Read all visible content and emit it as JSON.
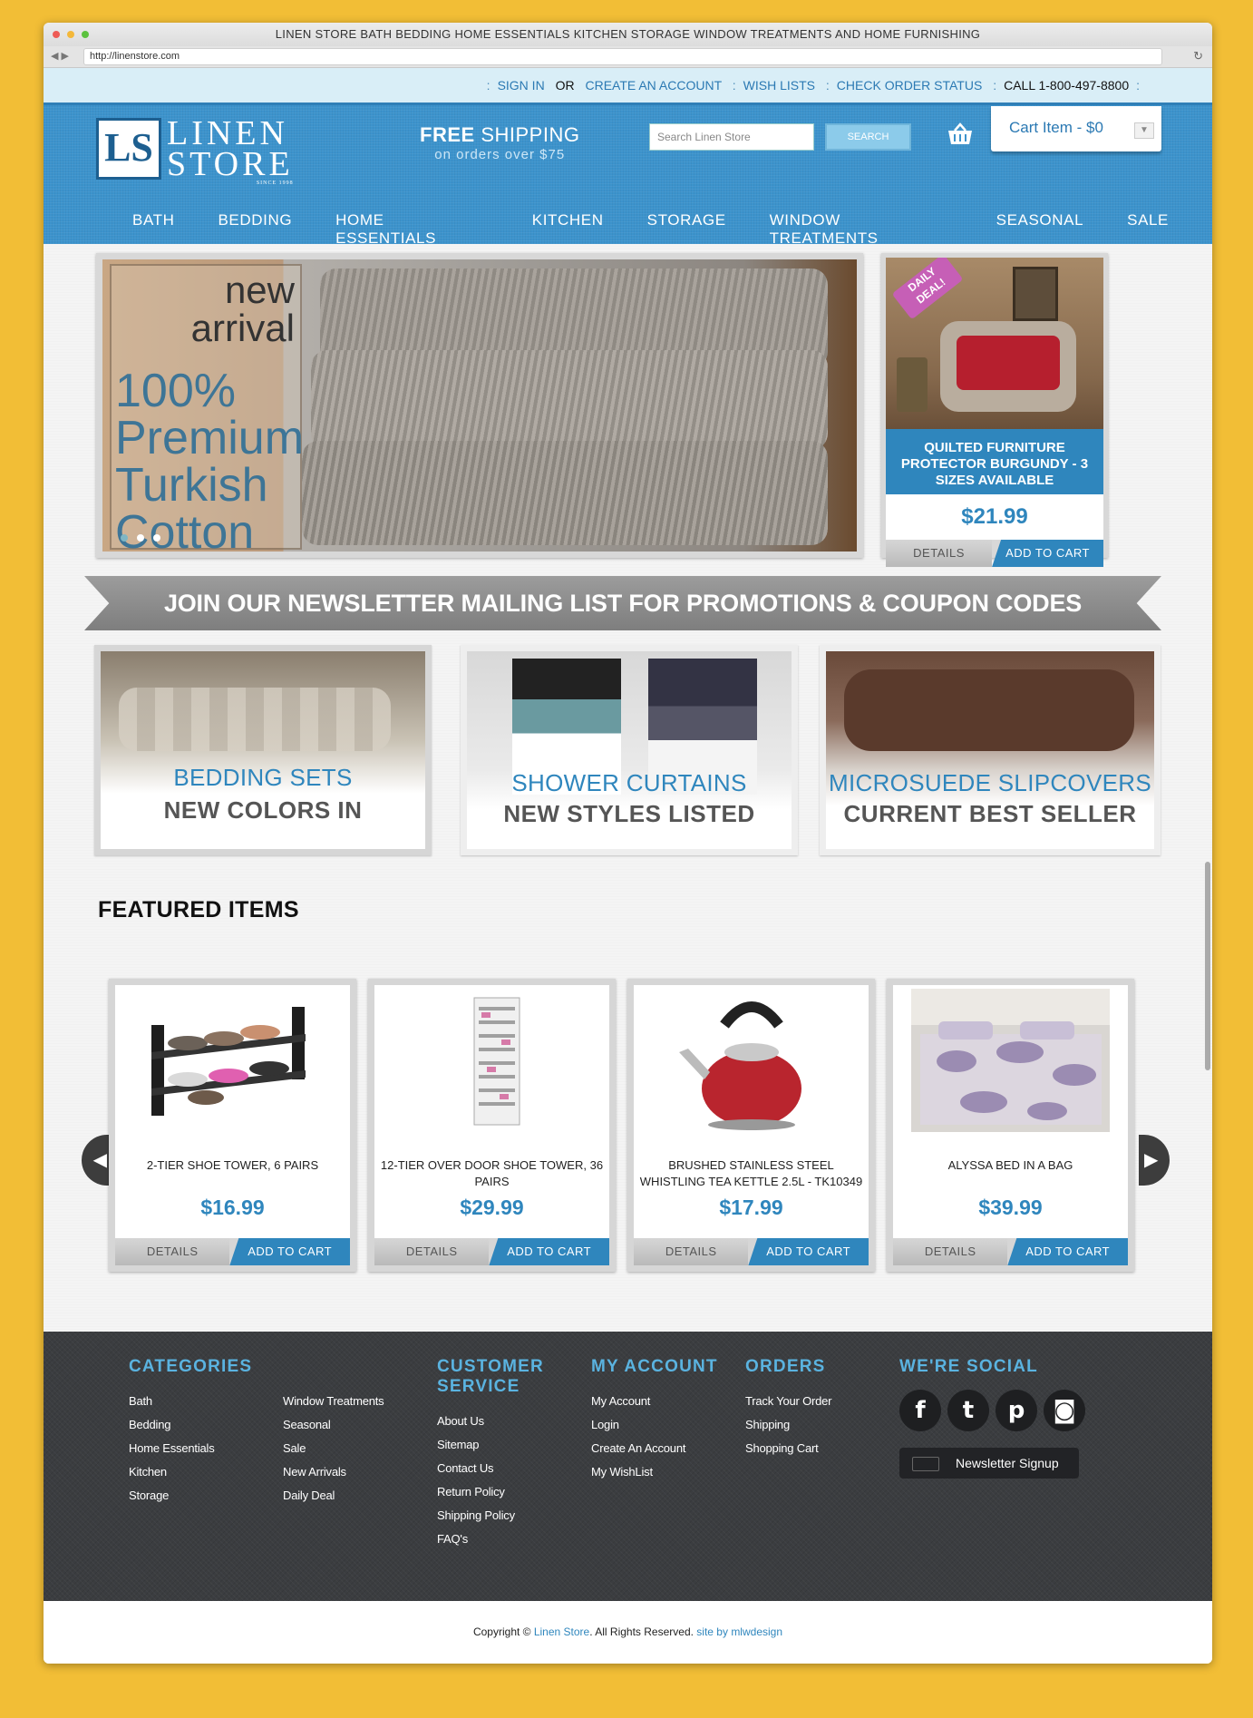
{
  "window": {
    "title": "LINEN STORE   BATH  BEDDING  HOME ESSENTIALS  KITCHEN  STORAGE  WINDOW TREATMENTS  AND HOME FURNISHING",
    "url": "http://linenstore.com"
  },
  "util": {
    "sign_in": "SIGN IN",
    "or": "OR",
    "create": "CREATE AN ACCOUNT",
    "wish": "WISH LISTS",
    "check": "CHECK ORDER STATUS",
    "call": "CALL 1-800-497-8800"
  },
  "header": {
    "logo_mark": "LS",
    "logo_line1": "LINEN",
    "logo_line2": "STORE",
    "logo_since": "SINCE 1998",
    "free_bold": "FREE",
    "free_rest": "SHIPPING",
    "free_sub": "on orders over $75",
    "search_placeholder": "Search Linen Store",
    "search_btn": "SEARCH",
    "cart": "Cart Item - $0"
  },
  "nav": [
    "BATH",
    "BEDDING",
    "HOME ESSENTIALS",
    "KITCHEN",
    "STORAGE",
    "WINDOW TREATMENTS",
    "SEASONAL",
    "SALE"
  ],
  "hero": {
    "line1": "new",
    "line2": "arrival",
    "t1": "100%",
    "t2": "Premium",
    "t3": "Turkish",
    "t4": "Cotton"
  },
  "deal": {
    "tag": "DAILY DEAL!",
    "title": "QUILTED FURNITURE PROTECTOR BURGUNDY - 3 SIZES AVAILABLE",
    "price": "$21.99",
    "details": "DETAILS",
    "add": "ADD TO CART"
  },
  "newsletter_banner": "JOIN OUR NEWSLETTER MAILING LIST FOR PROMOTIONS & COUPON CODES",
  "promos": [
    {
      "l1": "BEDDING SETS",
      "l2": "NEW COLORS IN"
    },
    {
      "l1": "SHOWER  CURTAINS",
      "l2": "NEW STYLES LISTED"
    },
    {
      "l1": "MICROSUEDE  SLIPCOVERS",
      "l2": "CURRENT BEST SELLER"
    }
  ],
  "featured": {
    "title": "FEATURED ITEMS",
    "items": [
      {
        "name": "2-TIER SHOE TOWER, 6 PAIRS",
        "price": "$16.99"
      },
      {
        "name": "12-TIER OVER DOOR SHOE TOWER, 36 PAIRS",
        "price": "$29.99"
      },
      {
        "name": "BRUSHED STAINLESS STEEL WHISTLING TEA KETTLE 2.5L - TK10349",
        "price": "$17.99"
      },
      {
        "name": "ALYSSA BED IN A BAG",
        "price": "$39.99"
      }
    ],
    "details": "DETAILS",
    "add": "ADD TO CART"
  },
  "footer": {
    "categories": {
      "title": "CATEGORIES",
      "col1": [
        "Bath",
        "Bedding",
        "Home Essentials",
        "Kitchen",
        "Storage"
      ],
      "col2": [
        "Window Treatments",
        "Seasonal",
        "Sale",
        "New Arrivals",
        "Daily Deal"
      ]
    },
    "service": {
      "title1": "CUSTOMER",
      "title2": "SERVICE",
      "items": [
        "About Us",
        "Sitemap",
        "Contact Us",
        "Return Policy",
        "Shipping Policy",
        "FAQ's"
      ]
    },
    "account": {
      "title": "MY ACCOUNT",
      "items": [
        "My Account",
        "Login",
        "Create An Account",
        "My WishList"
      ]
    },
    "orders": {
      "title": "ORDERS",
      "items": [
        "Track Your Order",
        "Shipping",
        "Shopping Cart"
      ]
    },
    "social": {
      "title": "WE'RE SOCIAL",
      "newsletter": "Newsletter Signup"
    }
  },
  "copyright": {
    "pre": "Copyright © ",
    "store": "Linen Store",
    "mid": ". All Rights Reserved. ",
    "site": "site by mlwdesign"
  }
}
